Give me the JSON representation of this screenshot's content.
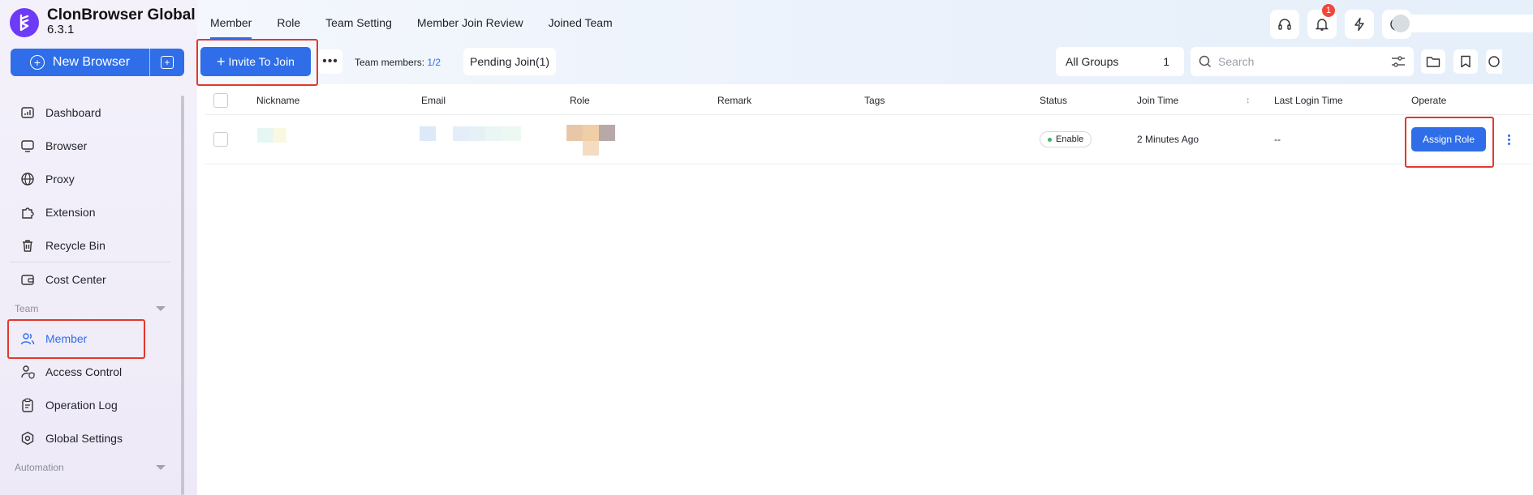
{
  "app": {
    "name": "ClonBrowser Global",
    "version": "6.3.1",
    "logo_icon": "clonbrowser-logo-icon"
  },
  "new_browser": {
    "label": "New Browser"
  },
  "sidebar": {
    "items": [
      {
        "label": "Dashboard",
        "icon": "dashboard-icon"
      },
      {
        "label": "Browser",
        "icon": "browser-icon"
      },
      {
        "label": "Proxy",
        "icon": "globe-icon"
      },
      {
        "label": "Extension",
        "icon": "puzzle-icon"
      },
      {
        "label": "Recycle Bin",
        "icon": "trash-icon"
      },
      {
        "label": "Cost Center",
        "icon": "wallet-icon"
      }
    ],
    "team_section": "Team",
    "team_items": [
      {
        "label": "Member",
        "icon": "users-icon",
        "active": true
      },
      {
        "label": "Access Control",
        "icon": "user-shield-icon"
      },
      {
        "label": "Operation Log",
        "icon": "clipboard-icon"
      },
      {
        "label": "Global Settings",
        "icon": "gear-icon"
      }
    ],
    "automation_section": "Automation"
  },
  "tabs": [
    "Member",
    "Role",
    "Team Setting",
    "Member Join Review",
    "Joined Team"
  ],
  "notifications": {
    "count": "1"
  },
  "toolbar": {
    "invite_label": "Invite To Join",
    "team_members_label": "Team members:",
    "team_members_count": "1/2",
    "pending_label": "Pending Join(1)",
    "groups_label": "All Groups",
    "groups_count": "1",
    "search_placeholder": "Search"
  },
  "table": {
    "headers": [
      "Nickname",
      "Email",
      "Role",
      "Remark",
      "Tags",
      "Status",
      "Join Time",
      "Last Login Time",
      "Operate"
    ],
    "rows": [
      {
        "status": "Enable",
        "join_time": "2 Minutes Ago",
        "last_login": "--",
        "action": "Assign Role"
      }
    ]
  },
  "colors": {
    "accent": "#2f6ee8",
    "highlight": "#e0392b",
    "badge": "#f0463c"
  }
}
